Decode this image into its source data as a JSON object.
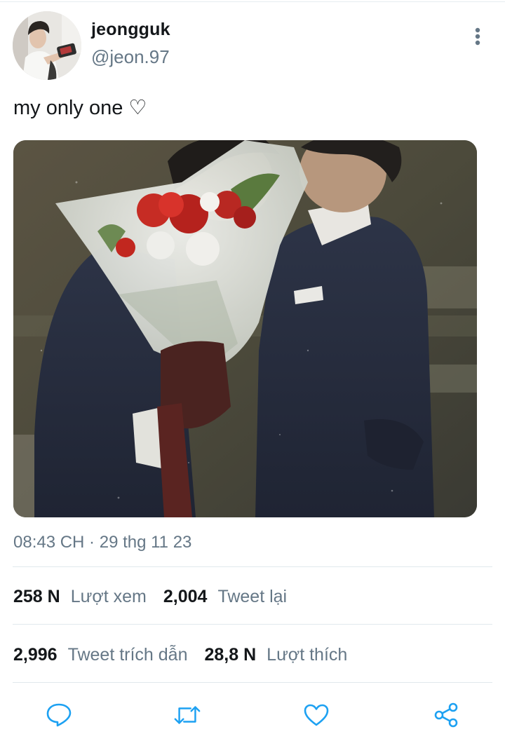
{
  "tweet": {
    "display_name": "jeongguk",
    "handle": "@jeon.97",
    "text": "my only one ♡",
    "timestamp": "08:43 CH · 29 thg 11 23"
  },
  "stats": {
    "views_value": "258 N",
    "views_label": "Lượt xem",
    "retweets_value": "2,004",
    "retweets_label": "Tweet lại",
    "quotes_value": "2,996",
    "quotes_label": "Tweet trích dẫn",
    "likes_value": "28,8 N",
    "likes_label": "Lượt thích"
  },
  "icons": {
    "more": "more-vertical-icon",
    "reply": "reply-icon",
    "retweet": "retweet-icon",
    "like": "heart-icon",
    "share": "share-icon"
  },
  "colors": {
    "text_primary": "#14171a",
    "text_secondary": "#657786",
    "divider": "#e1e8ed",
    "icon": "#1da1f2"
  }
}
